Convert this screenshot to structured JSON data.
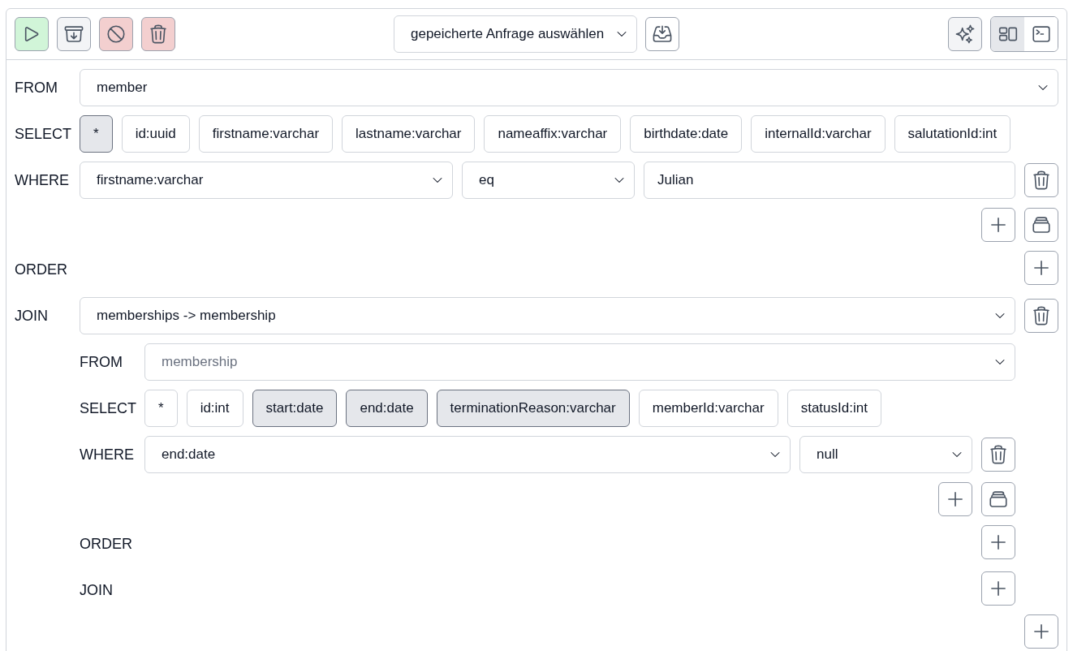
{
  "toolbar": {
    "actions": [
      {
        "kind": "run",
        "color": "#d1f5d8"
      },
      {
        "kind": "archive",
        "color": "#f3f4f6"
      },
      {
        "kind": "cancel",
        "color": "#f3cfcf"
      },
      {
        "kind": "delete",
        "color": "#f3cfcf"
      }
    ],
    "saved_query": {
      "value": "gepeicherte Anfrage auswählen"
    },
    "views": [
      {
        "kind": "builder",
        "selected": true
      },
      {
        "kind": "console",
        "selected": false
      }
    ]
  },
  "query": {
    "from": {
      "label": "FROM",
      "value": "member",
      "disabled": false
    },
    "select": {
      "label": "SELECT",
      "columns": [
        {
          "label": "*",
          "selected": true
        },
        {
          "label": "id:uuid",
          "selected": false
        },
        {
          "label": "firstname:varchar",
          "selected": false
        },
        {
          "label": "lastname:varchar",
          "selected": false
        },
        {
          "label": "nameaffix:varchar",
          "selected": false
        },
        {
          "label": "birthdate:date",
          "selected": false
        },
        {
          "label": "internalId:varchar",
          "selected": false
        },
        {
          "label": "salutationId:int",
          "selected": false
        }
      ]
    },
    "where": {
      "label": "WHERE",
      "conditions": [
        {
          "field": "firstname:varchar",
          "operator": "eq",
          "value": "Julian"
        }
      ]
    },
    "order": {
      "label": "ORDER"
    },
    "join": {
      "label": "JOIN",
      "joins": [
        {
          "relation": "memberships -> membership",
          "query": {
            "from": {
              "label": "FROM",
              "value": "membership",
              "disabled": true
            },
            "select": {
              "label": "SELECT",
              "columns": [
                {
                  "label": "*",
                  "selected": false
                },
                {
                  "label": "id:int",
                  "selected": false
                },
                {
                  "label": "start:date",
                  "selected": true
                },
                {
                  "label": "end:date",
                  "selected": true
                },
                {
                  "label": "terminationReason:varchar",
                  "selected": true
                },
                {
                  "label": "memberId:varchar",
                  "selected": false
                },
                {
                  "label": "statusId:int",
                  "selected": false
                }
              ]
            },
            "where": {
              "label": "WHERE",
              "conditions": [
                {
                  "field": "end:date",
                  "operator": "null"
                }
              ]
            },
            "order": {
              "label": "ORDER"
            },
            "join": {
              "label": "JOIN"
            }
          }
        }
      ]
    }
  }
}
